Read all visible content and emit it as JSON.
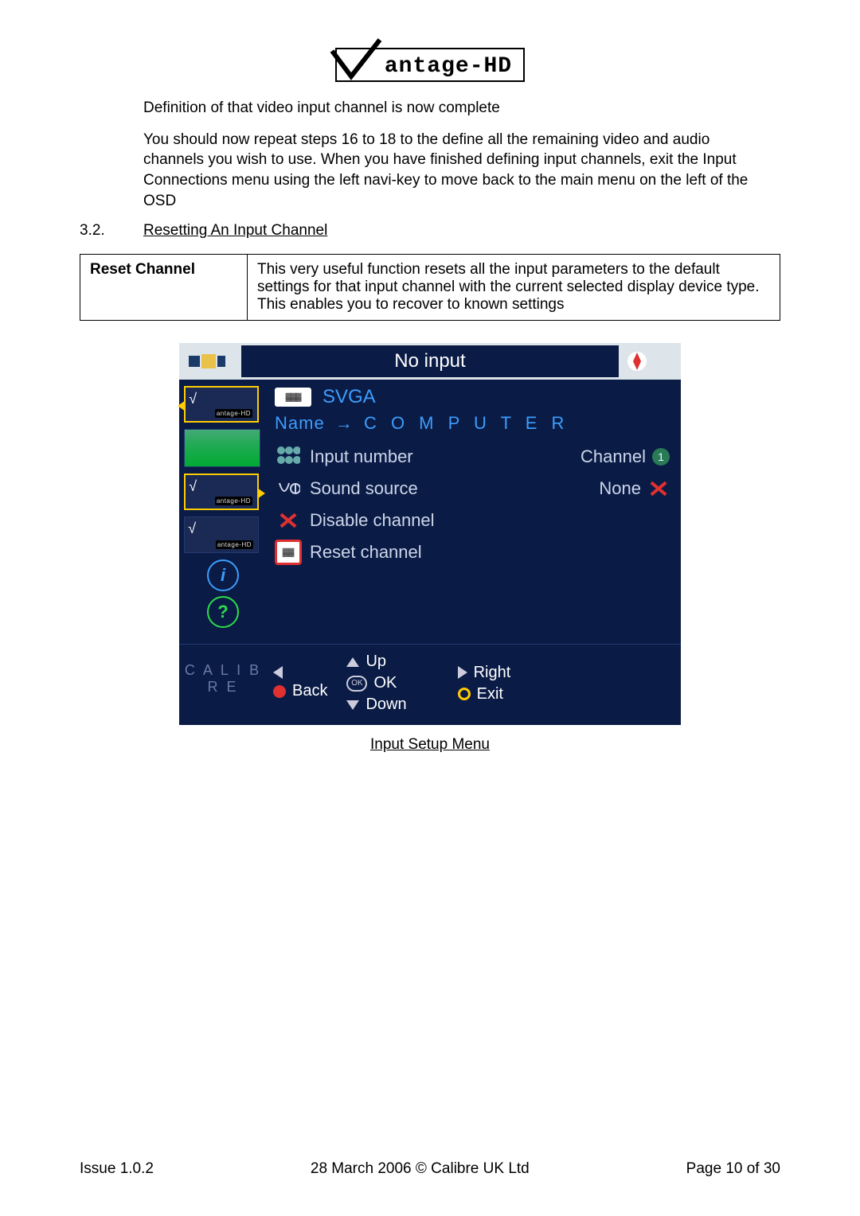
{
  "logo_text": "antage-HD",
  "paragraph1": "Definition of that video input channel is now complete",
  "paragraph2": "You should now repeat steps 16 to 18 to the define all the remaining video and audio channels you wish to use. When you have finished defining input channels, exit the Input Connections menu using the left navi-key to move back to the main menu on the left of the OSD",
  "section_number": "3.2.",
  "section_title": "Resetting  An Input Channel",
  "table": {
    "label": "Reset Channel",
    "desc": "This very useful function resets all the input parameters to the default settings for that input channel with the current selected display device type. This enables you to recover to known settings"
  },
  "osd": {
    "top_title": "No input",
    "svga": "SVGA",
    "name_label": "Name",
    "name_value": "C O M P U T E R",
    "items": {
      "input_number": "Input number",
      "channel_label": "Channel",
      "channel_value": "1",
      "sound_source": "Sound source",
      "sound_value": "None",
      "disable": "Disable channel",
      "reset": "Reset channel"
    },
    "side_brand": "antage-HD",
    "calibre": "C A L I B R E",
    "foot": {
      "back": "Back",
      "up": "Up",
      "ok": "OK",
      "down": "Down",
      "right": "Right",
      "exit": "Exit"
    }
  },
  "caption": "Input Setup Menu",
  "footer": {
    "left": "Issue 1.0.2",
    "center": "28 March 2006 © Calibre UK Ltd",
    "right": "Page 10 of 30"
  }
}
